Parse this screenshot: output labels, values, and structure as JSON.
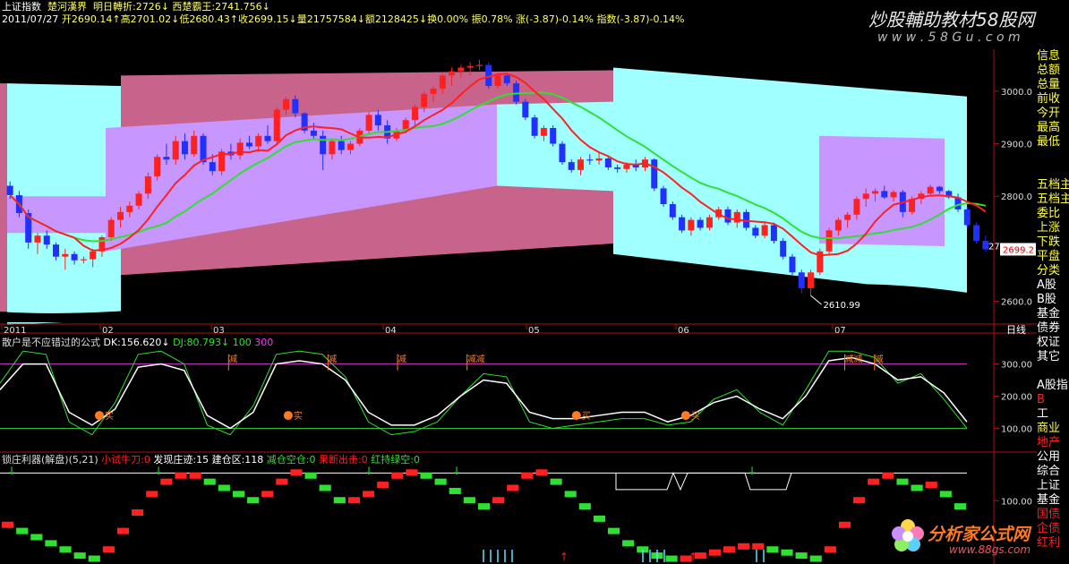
{
  "header": {
    "index_name": "上证指数",
    "study1": "楚河漢界",
    "study2_label": "明日轉折:2726↓",
    "study3_label": "西楚霸王:2741.756↓",
    "date": "2011/07/27",
    "quote": "开2690.14↑高2701.02↓低2680.43↑收2699.15↓量21757584↓额2128425↓换0.00% 振0.78% 涨(-3.87)-0.14% 指数(-3.87)-0.14%"
  },
  "watermark": {
    "text": "炒股輔助教材58股网",
    "url": "w w w . 5 8 G u . c o m"
  },
  "logo": {
    "text": "分析家公式网",
    "url": "www.88gs.com"
  },
  "colors": {
    "up": "#ff2020",
    "down": "#2030ff",
    "cyan": "#a0ffff",
    "pink": "#c8648c",
    "violet": "#c896ff",
    "ma1": "#ff2020",
    "ma2": "#30e030",
    "grid": "#a00000",
    "axis": "#b01010"
  },
  "right_panel": {
    "items": [
      "信息",
      "总额",
      "总量",
      "前收",
      "今开",
      "最高",
      "最低",
      "",
      "",
      "五档主",
      "五档主",
      "委比",
      "上涨",
      "下跌",
      "平盘",
      "分类",
      "A股",
      "B股",
      "基金",
      "债券",
      "权证",
      "其它",
      "",
      "A股指",
      "B",
      "工",
      "商业",
      "地产",
      "公用",
      "综合",
      "上证",
      "基金",
      "国债",
      "企债",
      "红利"
    ]
  },
  "chart_data": [
    {
      "type": "candlestick",
      "title": "上证指数",
      "period_label": "日线",
      "x_ticks": [
        "2011",
        "02",
        "03",
        "04",
        "05",
        "06",
        "07"
      ],
      "y_ticks": [
        2600,
        2700,
        2800,
        2900,
        3000
      ],
      "ylim": [
        2560,
        3080
      ],
      "last_price": "2699.2",
      "low_annotation": "2610.99",
      "marker_27": "27",
      "candles": [
        [
          2820,
          2828,
          2795,
          2802
        ],
        [
          2802,
          2810,
          2760,
          2768
        ],
        [
          2768,
          2775,
          2700,
          2712
        ],
        [
          2712,
          2730,
          2690,
          2725
        ],
        [
          2725,
          2735,
          2700,
          2708
        ],
        [
          2708,
          2712,
          2678,
          2685
        ],
        [
          2685,
          2700,
          2660,
          2690
        ],
        [
          2690,
          2695,
          2670,
          2678
        ],
        [
          2678,
          2685,
          2672,
          2680
        ],
        [
          2680,
          2700,
          2665,
          2695
        ],
        [
          2695,
          2725,
          2685,
          2722
        ],
        [
          2722,
          2760,
          2715,
          2755
        ],
        [
          2755,
          2780,
          2740,
          2770
        ],
        [
          2770,
          2790,
          2760,
          2782
        ],
        [
          2782,
          2810,
          2775,
          2805
        ],
        [
          2805,
          2845,
          2795,
          2838
        ],
        [
          2838,
          2880,
          2830,
          2875
        ],
        [
          2875,
          2900,
          2860,
          2870
        ],
        [
          2870,
          2915,
          2860,
          2905
        ],
        [
          2905,
          2920,
          2870,
          2880
        ],
        [
          2880,
          2925,
          2875,
          2915
        ],
        [
          2915,
          2920,
          2860,
          2865
        ],
        [
          2865,
          2880,
          2840,
          2848
        ],
        [
          2848,
          2890,
          2840,
          2885
        ],
        [
          2885,
          2900,
          2870,
          2878
        ],
        [
          2878,
          2910,
          2870,
          2902
        ],
        [
          2902,
          2915,
          2890,
          2895
        ],
        [
          2895,
          2920,
          2885,
          2915
        ],
        [
          2915,
          2935,
          2900,
          2905
        ],
        [
          2905,
          2970,
          2900,
          2965
        ],
        [
          2965,
          2990,
          2955,
          2985
        ],
        [
          2985,
          2992,
          2950,
          2958
        ],
        [
          2958,
          2960,
          2920,
          2925
        ],
        [
          2925,
          2940,
          2910,
          2915
        ],
        [
          2915,
          2925,
          2850,
          2880
        ],
        [
          2880,
          2910,
          2870,
          2905
        ],
        [
          2905,
          2915,
          2880,
          2888
        ],
        [
          2888,
          2905,
          2880,
          2900
        ],
        [
          2900,
          2930,
          2895,
          2925
        ],
        [
          2925,
          2960,
          2920,
          2955
        ],
        [
          2955,
          2965,
          2925,
          2935
        ],
        [
          2935,
          2945,
          2900,
          2910
        ],
        [
          2910,
          2930,
          2905,
          2925
        ],
        [
          2925,
          2950,
          2920,
          2945
        ],
        [
          2945,
          2975,
          2935,
          2970
        ],
        [
          2970,
          3000,
          2960,
          2995
        ],
        [
          2995,
          3010,
          2980,
          3005
        ],
        [
          3005,
          3035,
          2995,
          3030
        ],
        [
          3030,
          3045,
          3010,
          3038
        ],
        [
          3038,
          3050,
          3025,
          3045
        ],
        [
          3045,
          3055,
          3030,
          3048
        ],
        [
          3048,
          3060,
          3040,
          3050
        ],
        [
          3050,
          3055,
          3005,
          3010
        ],
        [
          3010,
          3035,
          3005,
          3030
        ],
        [
          3030,
          3035,
          3010,
          3015
        ],
        [
          3015,
          3020,
          2975,
          2980
        ],
        [
          2980,
          2985,
          2945,
          2950
        ],
        [
          2950,
          2955,
          2910,
          2915
        ],
        [
          2915,
          2935,
          2905,
          2930
        ],
        [
          2930,
          2935,
          2895,
          2900
        ],
        [
          2900,
          2905,
          2860,
          2865
        ],
        [
          2865,
          2870,
          2845,
          2850
        ],
        [
          2850,
          2875,
          2840,
          2870
        ],
        [
          2870,
          2880,
          2860,
          2868
        ],
        [
          2868,
          2885,
          2860,
          2872
        ],
        [
          2872,
          2878,
          2850,
          2855
        ],
        [
          2855,
          2860,
          2845,
          2852
        ],
        [
          2852,
          2865,
          2845,
          2860
        ],
        [
          2860,
          2870,
          2848,
          2855
        ],
        [
          2855,
          2875,
          2848,
          2870
        ],
        [
          2870,
          2872,
          2810,
          2815
        ],
        [
          2815,
          2820,
          2780,
          2785
        ],
        [
          2785,
          2790,
          2755,
          2760
        ],
        [
          2760,
          2765,
          2730,
          2735
        ],
        [
          2735,
          2760,
          2725,
          2755
        ],
        [
          2755,
          2760,
          2735,
          2740
        ],
        [
          2740,
          2765,
          2735,
          2760
        ],
        [
          2760,
          2780,
          2755,
          2775
        ],
        [
          2775,
          2780,
          2745,
          2750
        ],
        [
          2750,
          2775,
          2740,
          2770
        ],
        [
          2770,
          2775,
          2735,
          2740
        ],
        [
          2740,
          2745,
          2720,
          2725
        ],
        [
          2725,
          2750,
          2720,
          2745
        ],
        [
          2745,
          2750,
          2710,
          2715
        ],
        [
          2715,
          2720,
          2680,
          2685
        ],
        [
          2685,
          2690,
          2650,
          2655
        ],
        [
          2655,
          2660,
          2615,
          2625
        ],
        [
          2625,
          2660,
          2611,
          2655
        ],
        [
          2655,
          2700,
          2650,
          2695
        ],
        [
          2695,
          2740,
          2690,
          2735
        ],
        [
          2735,
          2760,
          2725,
          2755
        ],
        [
          2755,
          2770,
          2740,
          2765
        ],
        [
          2765,
          2800,
          2755,
          2795
        ],
        [
          2795,
          2815,
          2780,
          2805
        ],
        [
          2805,
          2815,
          2790,
          2810
        ],
        [
          2810,
          2820,
          2795,
          2798
        ],
        [
          2798,
          2812,
          2790,
          2808
        ],
        [
          2808,
          2812,
          2760,
          2770
        ],
        [
          2770,
          2800,
          2765,
          2795
        ],
        [
          2795,
          2810,
          2785,
          2805
        ],
        [
          2805,
          2822,
          2800,
          2818
        ],
        [
          2818,
          2820,
          2805,
          2810
        ],
        [
          2810,
          2812,
          2795,
          2798
        ],
        [
          2798,
          2805,
          2770,
          2775
        ],
        [
          2775,
          2780,
          2740,
          2745
        ],
        [
          2745,
          2750,
          2710,
          2715
        ],
        [
          2715,
          2725,
          2695,
          2699
        ]
      ]
    },
    {
      "type": "line",
      "title": "散户是不应错过的公式",
      "readouts": [
        "DK:156.620↓",
        "DJ:80.793↓",
        "100",
        "300"
      ],
      "y_ticks": [
        100,
        200,
        300
      ],
      "ylim": [
        40,
        360
      ],
      "signals": [
        {
          "label": "减",
          "pos": 0.23
        },
        {
          "label": "减",
          "pos": 0.33
        },
        {
          "label": "减",
          "pos": 0.4
        },
        {
          "label": "减减",
          "pos": 0.47
        },
        {
          "label": "实",
          "pos": 0.1,
          "kind": "buy"
        },
        {
          "label": "实",
          "pos": 0.29,
          "kind": "buy"
        },
        {
          "label": "买",
          "pos": 0.58,
          "kind": "buy"
        },
        {
          "label": "买",
          "pos": 0.69,
          "kind": "buy"
        },
        {
          "label": "减减",
          "pos": 0.85
        },
        {
          "label": "减",
          "pos": 0.88
        }
      ]
    },
    {
      "type": "bar",
      "title": "锁庄利器(解盘)(5,21)",
      "legend": [
        {
          "name": "小试牛刀:0",
          "color": "#ff2020"
        },
        {
          "name": "发现庄迹:15",
          "color": "#ffffff"
        },
        {
          "name": "建仓区:118",
          "color": "#ffffff"
        },
        {
          "name": "减仓空仓:0",
          "color": "#30e030"
        },
        {
          "name": "果断出击:0",
          "color": "#ff2020"
        },
        {
          "name": "红持绿空:0",
          "color": "#30e030"
        }
      ],
      "y_ticks": [
        100
      ],
      "ylim": [
        0,
        160
      ]
    }
  ]
}
